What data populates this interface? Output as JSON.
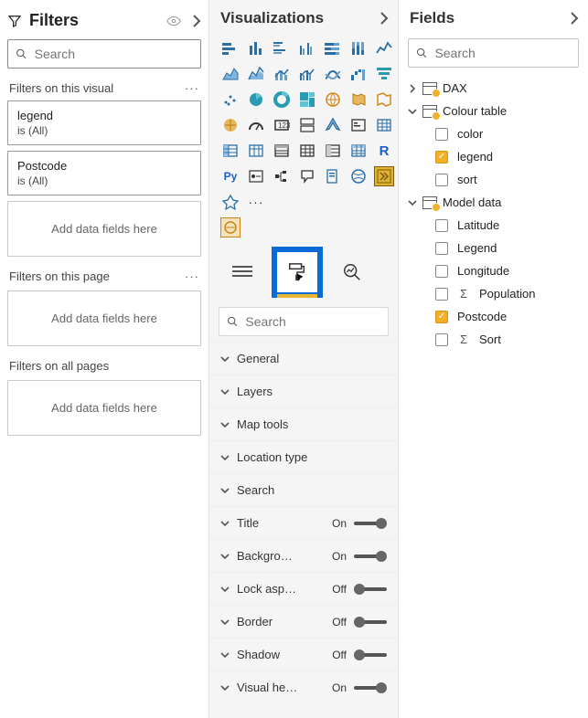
{
  "filters": {
    "title": "Filters",
    "search_placeholder": "Search",
    "visual_section": "Filters on this visual",
    "cards": [
      {
        "title": "legend",
        "sub": "is (All)"
      },
      {
        "title": "Postcode",
        "sub": "is (All)"
      }
    ],
    "drop_visual": "Add data fields here",
    "page_section": "Filters on this page",
    "drop_page": "Add data fields here",
    "all_section": "Filters on all pages",
    "drop_all": "Add data fields here"
  },
  "viz": {
    "title": "Visualizations",
    "search_placeholder": "Search",
    "accordion": [
      {
        "label": "General",
        "toggle": null
      },
      {
        "label": "Layers",
        "toggle": null
      },
      {
        "label": "Map tools",
        "toggle": null
      },
      {
        "label": "Location type",
        "toggle": null
      },
      {
        "label": "Search",
        "toggle": null
      },
      {
        "label": "Title",
        "toggle": "On"
      },
      {
        "label": "Backgro…",
        "toggle": "On"
      },
      {
        "label": "Lock asp…",
        "toggle": "Off"
      },
      {
        "label": "Border",
        "toggle": "Off"
      },
      {
        "label": "Shadow",
        "toggle": "Off"
      },
      {
        "label": "Visual he…",
        "toggle": "On"
      }
    ]
  },
  "fields": {
    "title": "Fields",
    "search_placeholder": "Search",
    "groups": [
      {
        "name": "DAX",
        "expanded": false,
        "children": []
      },
      {
        "name": "Colour table",
        "expanded": true,
        "children": [
          {
            "name": "color",
            "checked": false,
            "sigma": false
          },
          {
            "name": "legend",
            "checked": true,
            "sigma": false
          },
          {
            "name": "sort",
            "checked": false,
            "sigma": false
          }
        ]
      },
      {
        "name": "Model data",
        "expanded": true,
        "children": [
          {
            "name": "Latitude",
            "checked": false,
            "sigma": false
          },
          {
            "name": "Legend",
            "checked": false,
            "sigma": false
          },
          {
            "name": "Longitude",
            "checked": false,
            "sigma": false
          },
          {
            "name": "Population",
            "checked": false,
            "sigma": true
          },
          {
            "name": "Postcode",
            "checked": true,
            "sigma": false
          },
          {
            "name": "Sort",
            "checked": false,
            "sigma": true
          }
        ]
      }
    ]
  }
}
